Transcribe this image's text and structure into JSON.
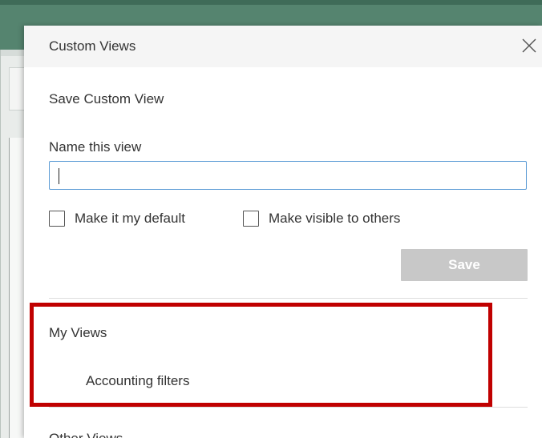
{
  "dialog": {
    "title": "Custom Views",
    "close_icon": "close-icon"
  },
  "save_section": {
    "title": "Save Custom View",
    "name_label": "Name this view",
    "name_value": "",
    "checkbox_default": {
      "label": "Make it my default",
      "checked": false
    },
    "checkbox_visible": {
      "label": "Make visible to others",
      "checked": false
    },
    "save_label": "Save"
  },
  "my_views": {
    "title": "My Views",
    "items": [
      "Accounting filters"
    ]
  },
  "other_views": {
    "title": "Other Views"
  },
  "colors": {
    "background_green": "#55846f",
    "highlight_red": "#c00000",
    "input_border": "#5b9bd5",
    "save_disabled": "#c8c8c8"
  }
}
